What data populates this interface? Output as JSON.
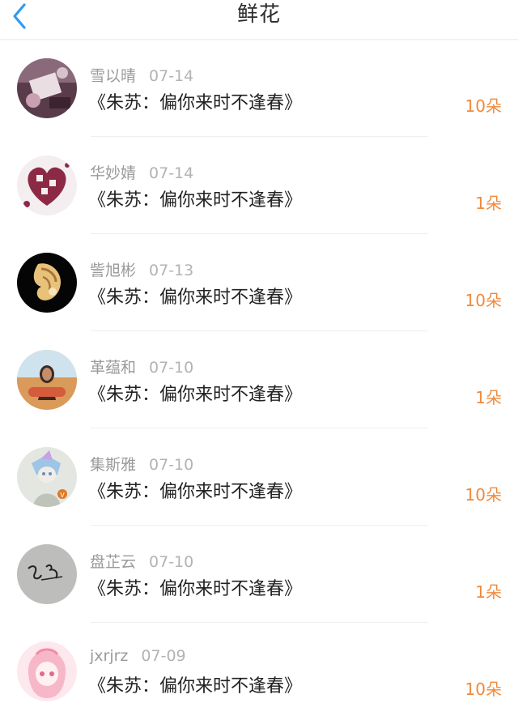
{
  "header": {
    "title": "鲜花",
    "back_icon": "chevron-left-icon"
  },
  "colors": {
    "accent": "#2f9bf0",
    "count": "#f08a3c",
    "name": "#9a9a9a",
    "title": "#222222"
  },
  "rows": [
    {
      "name": "雪以晴",
      "date": "07-14",
      "book": "《朱苏：偏你来时不逢春》",
      "count": "10朵"
    },
    {
      "name": "华妙婧",
      "date": "07-14",
      "book": "《朱苏：偏你来时不逢春》",
      "count": "1朵"
    },
    {
      "name": "訾旭彬",
      "date": "07-13",
      "book": "《朱苏：偏你来时不逢春》",
      "count": "10朵"
    },
    {
      "name": "革蕴和",
      "date": "07-10",
      "book": "《朱苏：偏你来时不逢春》",
      "count": "1朵"
    },
    {
      "name": "集斯雅",
      "date": "07-10",
      "book": "《朱苏：偏你来时不逢春》",
      "count": "10朵"
    },
    {
      "name": "盘芷云",
      "date": "07-10",
      "book": "《朱苏：偏你来时不逢春》",
      "count": "1朵"
    },
    {
      "name": "jxrjrz",
      "date": "07-09",
      "book": "《朱苏：偏你来时不逢春》",
      "count": "10朵"
    }
  ]
}
